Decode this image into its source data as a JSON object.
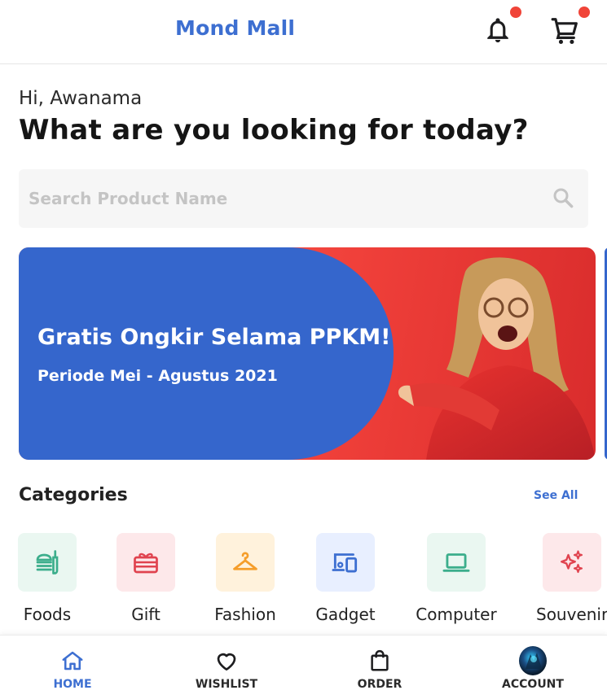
{
  "header": {
    "brand": "Mond Mall",
    "icons": [
      "bell-icon",
      "cart-icon"
    ],
    "notification_dot_color": "#f04438"
  },
  "greeting": "Hi, Awanama",
  "headline": "What are you looking for today?",
  "search": {
    "placeholder": "Search Product Name",
    "value": ""
  },
  "banner": {
    "title": "Gratis Ongkir Selama PPKM!",
    "subtitle": "Periode Mei - Agustus 2021",
    "bg_color": "#3566cc"
  },
  "categories": {
    "title": "Categories",
    "see_all": "See All",
    "items": [
      {
        "label": "Foods",
        "icon": "food-icon",
        "color": "#3cae8c",
        "bg": "#eaf7f1"
      },
      {
        "label": "Gift",
        "icon": "gift-icon",
        "color": "#e0434f",
        "bg": "#fde8ea"
      },
      {
        "label": "Fashion",
        "icon": "hanger-icon",
        "color": "#f59e2b",
        "bg": "#fff2dc"
      },
      {
        "label": "Gadget",
        "icon": "devices-icon",
        "color": "#3d6fd1",
        "bg": "#e8efff"
      },
      {
        "label": "Computer",
        "icon": "laptop-icon",
        "color": "#3cae8c",
        "bg": "#eaf7f1"
      },
      {
        "label": "Souvenir",
        "icon": "sparkles-icon",
        "color": "#e0434f",
        "bg": "#fde8ea"
      }
    ]
  },
  "bottom_nav": {
    "items": [
      {
        "label": "HOME",
        "icon": "home-icon",
        "active": true
      },
      {
        "label": "WISHLIST",
        "icon": "heart-icon",
        "active": false
      },
      {
        "label": "ORDER",
        "icon": "shopping-bag-icon",
        "active": false
      },
      {
        "label": "ACCOUNT",
        "icon": "avatar",
        "active": false
      }
    ],
    "active_color": "#3d6fd1"
  }
}
